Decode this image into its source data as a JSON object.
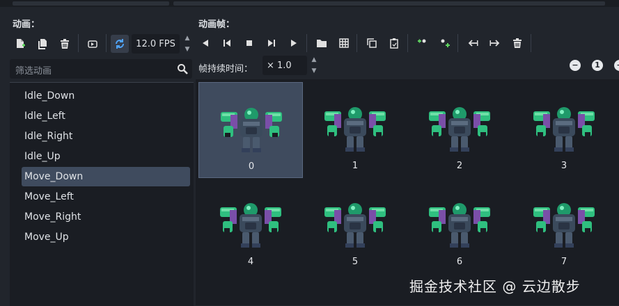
{
  "animations_panel": {
    "label": "动画：",
    "filter_placeholder": "筛选动画",
    "items": [
      "Idle_Down",
      "Idle_Left",
      "Idle_Right",
      "Idle_Up",
      "Move_Down",
      "Move_Left",
      "Move_Right",
      "Move_Up"
    ],
    "selected": "Move_Down",
    "fps": "12.0 FPS"
  },
  "frames_panel": {
    "label": "动画帧：",
    "duration_label": "帧持续时间：",
    "duration_value": "× 1.0",
    "zoom_reset": "1",
    "frames": [
      "0",
      "1",
      "2",
      "3",
      "4",
      "5",
      "6",
      "7"
    ],
    "selected_frame": "0"
  },
  "watermark": "掘金技术社区 @ 云边散步",
  "colors": {
    "accent": "#4fa3f7",
    "selection": "#3f4b5e",
    "sprite_green": "#2fbf7f",
    "sprite_purple": "#7a4fa8"
  }
}
